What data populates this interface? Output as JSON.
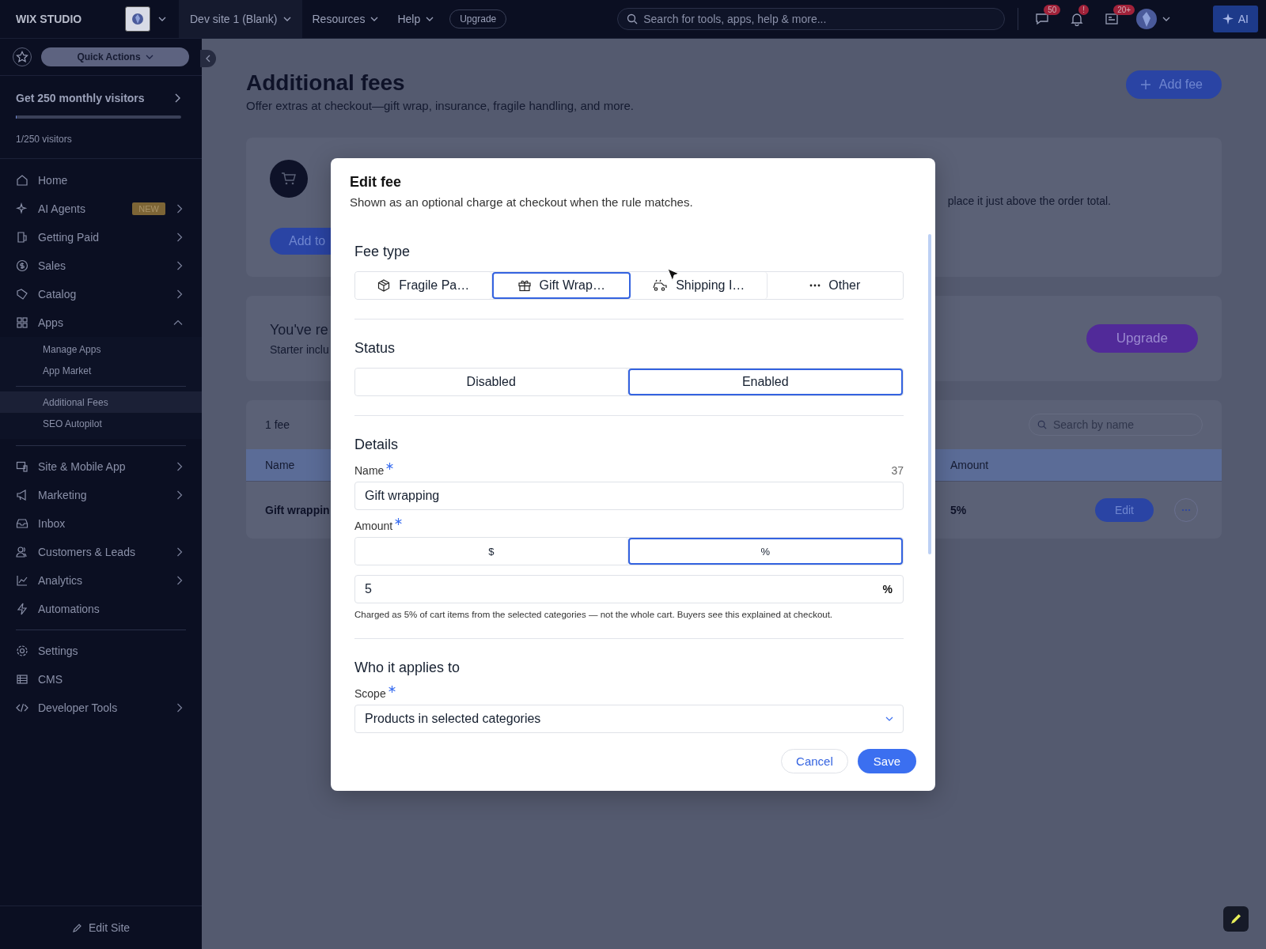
{
  "topbar": {
    "logo": "WIX STUDIO",
    "site": "Dev site 1 (Blank)",
    "menus": [
      "Resources",
      "Help"
    ],
    "upgrade": "Upgrade",
    "search_placeholder": "Search for tools, apps, help & more...",
    "badges": [
      "50",
      "!",
      "20+"
    ],
    "ai": "AI"
  },
  "sidebar": {
    "quick_actions": "Quick Actions",
    "promo": {
      "title": "Get 250 monthly visitors",
      "level": 0.004,
      "count": "1/250 visitors"
    },
    "groups": [
      [
        {
          "label": "Home"
        },
        {
          "label": "AI Agents",
          "badge": "NEW",
          "expanded": false
        },
        {
          "label": "Getting Paid",
          "expanded": false
        },
        {
          "label": "Sales",
          "expanded": false
        },
        {
          "label": "Catalog",
          "expanded": false
        },
        {
          "label": "Apps",
          "expanded": true,
          "children": [
            [
              {
                "label": "Manage Apps",
                "selected": false
              },
              {
                "label": "App Market",
                "selected": false
              }
            ],
            [
              {
                "label": "Additional Fees",
                "selected": true
              },
              {
                "label": "SEO Autopilot",
                "selected": false
              }
            ]
          ]
        }
      ],
      [
        {
          "label": "Site & Mobile App",
          "expanded": false
        },
        {
          "label": "Marketing",
          "expanded": false
        },
        {
          "label": "Inbox"
        },
        {
          "label": "Customers & Leads",
          "expanded": false
        },
        {
          "label": "Analytics",
          "expanded": false
        },
        {
          "label": "Automations"
        }
      ],
      [
        {
          "label": "Settings"
        },
        {
          "label": "CMS"
        },
        {
          "label": "Developer Tools",
          "expanded": false
        }
      ]
    ],
    "edit_site": "Edit Site"
  },
  "page": {
    "title": "Additional fees",
    "subtitle": "Offer extras at checkout—gift wrap, insurance, fragile handling, and more.",
    "add_button": "Add fee",
    "setup_card": {
      "button": "Add to",
      "text": "place it just above the order total."
    },
    "plan_card": {
      "title": "You've re",
      "text": "Starter inclu",
      "button": "Upgrade"
    },
    "table": {
      "count": "1 fee",
      "search_placeholder": "Search by name",
      "columns": [
        "Name",
        "Amount"
      ],
      "rows": [
        {
          "name": "Gift wrappin",
          "amount": "5%",
          "edit": "Edit"
        }
      ]
    }
  },
  "modal": {
    "title": "Edit fee",
    "subtitle": "Shown as an optional charge at checkout when the rule matches.",
    "fee_type": {
      "title": "Fee type",
      "options": [
        {
          "label": "Fragile Pa…",
          "selected": false
        },
        {
          "label": "Gift Wrap…",
          "selected": true
        },
        {
          "label": "Shipping I…",
          "selected": false
        },
        {
          "label": "Other",
          "selected": false
        }
      ]
    },
    "status": {
      "title": "Status",
      "options": [
        {
          "label": "Disabled",
          "selected": false
        },
        {
          "label": "Enabled",
          "selected": true
        }
      ]
    },
    "details": {
      "title": "Details",
      "name": {
        "label": "Name",
        "required": true,
        "counter": "37",
        "value": "Gift wrapping"
      },
      "amount": {
        "label": "Amount",
        "required": true,
        "modes": [
          {
            "label": "$",
            "selected": false
          },
          {
            "label": "%",
            "selected": true
          }
        ],
        "value": "5",
        "suffix": "%",
        "help": "Charged as 5% of cart items from the selected categories — not the whole cart. Buyers see this explained at checkout."
      }
    },
    "applies": {
      "title": "Who it applies to",
      "scope": {
        "label": "Scope",
        "required": true,
        "value": "Products in selected categories"
      }
    },
    "cancel": "Cancel",
    "save": "Save"
  }
}
